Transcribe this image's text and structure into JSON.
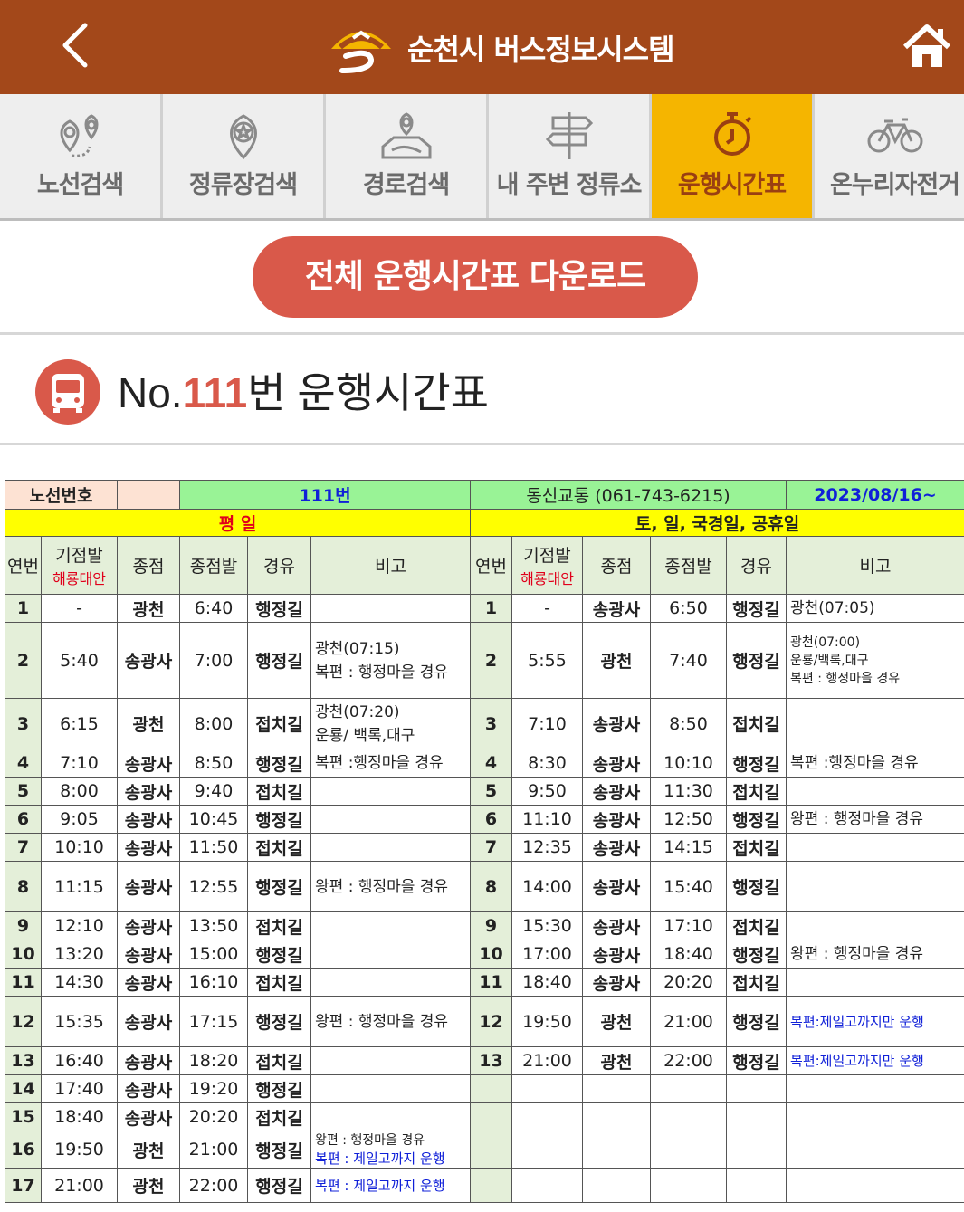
{
  "header": {
    "title": "순천시 버스정보시스템"
  },
  "tabs": [
    {
      "label": "노선검색",
      "icon": "route-pin-icon",
      "active": false
    },
    {
      "label": "정류장검색",
      "icon": "stop-pin-icon",
      "active": false
    },
    {
      "label": "경로검색",
      "icon": "map-route-icon",
      "active": false
    },
    {
      "label": "내 주변 정류소",
      "icon": "signpost-icon",
      "active": false
    },
    {
      "label": "운행시간표",
      "icon": "stopwatch-icon",
      "active": true
    },
    {
      "label": "온누리자전거",
      "icon": "bicycle-icon",
      "active": false
    }
  ],
  "download_label": "전체 운행시간표 다운로드",
  "page_title": {
    "prefix": "No.",
    "number": "111",
    "suffix": "번 운행시간표"
  },
  "table": {
    "route_label": "노선번호",
    "route_value": "111번",
    "company": "동신교통 (061-743-6215)",
    "date": "2023/08/16~",
    "weekday_label": "평 일",
    "holiday_label": "토, 일, 국경일, 공휴일",
    "col_no": "연번",
    "col_start": "기점발",
    "col_start_sub": "해룡대안",
    "col_end": "종점",
    "col_end_dep": "종점발",
    "col_via": "경유",
    "col_note": "비고",
    "weekday": [
      {
        "no": "1",
        "start": "-",
        "end": "광천",
        "dep": "6:40",
        "via": "행정길",
        "note": []
      },
      {
        "no": "2",
        "start": "5:40",
        "end": "송광사",
        "dep": "7:00",
        "via": "행정길",
        "note": [
          "광천(07:15)",
          "복편 : 행정마을 경유"
        ]
      },
      {
        "no": "3",
        "start": "6:15",
        "end": "광천",
        "dep": "8:00",
        "via": "접치길",
        "note": [
          "광천(07:20)",
          "운룡/ 백록,대구"
        ]
      },
      {
        "no": "4",
        "start": "7:10",
        "end": "송광사",
        "dep": "8:50",
        "via": "행정길",
        "note": [
          "복편 :행정마을 경유"
        ]
      },
      {
        "no": "5",
        "start": "8:00",
        "end": "송광사",
        "dep": "9:40",
        "via": "접치길",
        "note": []
      },
      {
        "no": "6",
        "start": "9:05",
        "end": "송광사",
        "dep": "10:45",
        "via": "행정길",
        "note": []
      },
      {
        "no": "7",
        "start": "10:10",
        "end": "송광사",
        "dep": "11:50",
        "via": "접치길",
        "note": []
      },
      {
        "no": "8",
        "start": "11:15",
        "end": "송광사",
        "dep": "12:55",
        "via": "행정길",
        "note": [
          "왕편 : 행정마을 경유"
        ]
      },
      {
        "no": "9",
        "start": "12:10",
        "end": "송광사",
        "dep": "13:50",
        "via": "접치길",
        "note": []
      },
      {
        "no": "10",
        "start": "13:20",
        "end": "송광사",
        "dep": "15:00",
        "via": "행정길",
        "note": []
      },
      {
        "no": "11",
        "start": "14:30",
        "end": "송광사",
        "dep": "16:10",
        "via": "접치길",
        "note": []
      },
      {
        "no": "12",
        "start": "15:35",
        "end": "송광사",
        "dep": "17:15",
        "via": "행정길",
        "note": [
          "왕편 : 행정마을 경유"
        ]
      },
      {
        "no": "13",
        "start": "16:40",
        "end": "송광사",
        "dep": "18:20",
        "via": "접치길",
        "note": []
      },
      {
        "no": "14",
        "start": "17:40",
        "end": "송광사",
        "dep": "19:20",
        "via": "행정길",
        "note": []
      },
      {
        "no": "15",
        "start": "18:40",
        "end": "송광사",
        "dep": "20:20",
        "via": "접치길",
        "note": []
      },
      {
        "no": "16",
        "start": "19:50",
        "end": "광천",
        "dep": "21:00",
        "via": "행정길",
        "note": [
          "왕편 : 행정마을 경유",
          "복편 : 제일고까지 운행"
        ]
      },
      {
        "no": "17",
        "start": "21:00",
        "end": "광천",
        "dep": "22:00",
        "via": "행정길",
        "note": [
          "복편 : 제일고까지 운행"
        ]
      }
    ],
    "holiday": [
      {
        "no": "1",
        "start": "-",
        "end": "송광사",
        "dep": "6:50",
        "via": "행정길",
        "note": [
          "광천(07:05)"
        ]
      },
      {
        "no": "2",
        "start": "5:55",
        "end": "광천",
        "dep": "7:40",
        "via": "행정길",
        "note": [
          "광천(07:00)",
          "운룡/백록,대구",
          "복편 : 행정마을 경유"
        ]
      },
      {
        "no": "3",
        "start": "7:10",
        "end": "송광사",
        "dep": "8:50",
        "via": "접치길",
        "note": []
      },
      {
        "no": "4",
        "start": "8:30",
        "end": "송광사",
        "dep": "10:10",
        "via": "행정길",
        "note": [
          "복편 :행정마을 경유"
        ]
      },
      {
        "no": "5",
        "start": "9:50",
        "end": "송광사",
        "dep": "11:30",
        "via": "접치길",
        "note": []
      },
      {
        "no": "6",
        "start": "11:10",
        "end": "송광사",
        "dep": "12:50",
        "via": "행정길",
        "note": [
          "왕편 : 행정마을 경유"
        ]
      },
      {
        "no": "7",
        "start": "12:35",
        "end": "송광사",
        "dep": "14:15",
        "via": "접치길",
        "note": []
      },
      {
        "no": "8",
        "start": "14:00",
        "end": "송광사",
        "dep": "15:40",
        "via": "행정길",
        "note": []
      },
      {
        "no": "9",
        "start": "15:30",
        "end": "송광사",
        "dep": "17:10",
        "via": "접치길",
        "note": []
      },
      {
        "no": "10",
        "start": "17:00",
        "end": "송광사",
        "dep": "18:40",
        "via": "행정길",
        "note": [
          "왕편 : 행정마을 경유"
        ]
      },
      {
        "no": "11",
        "start": "18:40",
        "end": "송광사",
        "dep": "20:20",
        "via": "접치길",
        "note": []
      },
      {
        "no": "12",
        "start": "19:50",
        "end": "광천",
        "dep": "21:00",
        "via": "행정길",
        "note": [
          "복편:제일고까지만 운행"
        ]
      },
      {
        "no": "13",
        "start": "21:00",
        "end": "광천",
        "dep": "22:00",
        "via": "행정길",
        "note": [
          "복편:제일고까지만 운행"
        ]
      }
    ]
  }
}
